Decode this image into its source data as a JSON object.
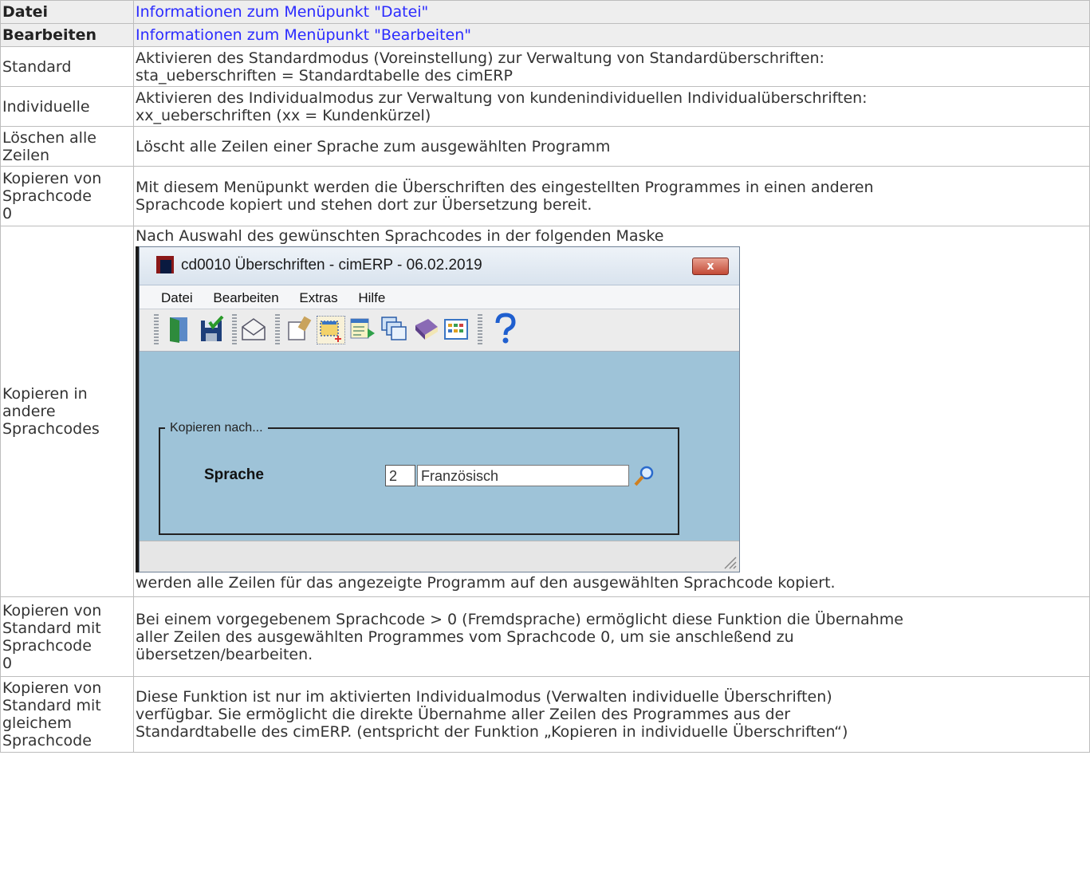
{
  "rows": [
    {
      "key": "Datei",
      "link": "Informationen zum Menüpunkt \"Datei\""
    },
    {
      "key": "Bearbeiten",
      "link": "Informationen zum Menüpunkt \"Bearbeiten\""
    },
    {
      "key": "Standard",
      "desc_lines": [
        "Aktivieren des Standardmodus (Voreinstellung) zur Verwaltung von Standardüberschriften:",
        "sta_ueberschriften = Standardtabelle des cimERP"
      ]
    },
    {
      "key": "Individuelle",
      "desc_lines": [
        "Aktivieren des Individualmodus zur Verwaltung von kundenindividuellen Individualüberschriften:",
        "xx_ueberschriften (xx = Kundenkürzel)"
      ]
    },
    {
      "key_lines": [
        "Löschen alle",
        "Zeilen"
      ],
      "desc": "Löscht alle Zeilen einer Sprache zum ausgewählten Programm"
    },
    {
      "key_lines": [
        "Kopieren von",
        "Sprachcode",
        "0"
      ],
      "desc_lines": [
        "Mit diesem Menüpunkt werden die Überschriften des eingestellten Programmes in einen anderen",
        "Sprachcode kopiert und stehen dort zur Übersetzung bereit."
      ]
    },
    {
      "key_lines": [
        "Kopieren in",
        "andere",
        "Sprachcodes"
      ],
      "desc_before": "Nach Auswahl des gewünschten Sprachcodes in der folgenden Maske",
      "desc_after": "werden alle Zeilen für das angezeigte Programm auf den ausgewählten Sprachcode kopiert."
    },
    {
      "key_lines": [
        "Kopieren von",
        "Standard mit",
        "Sprachcode",
        "0"
      ],
      "desc_lines": [
        "Bei einem vorgegebenem Sprachcode > 0 (Fremdsprache) ermöglicht diese Funktion die Übernahme",
        "aller Zeilen des ausgewählten Programmes vom Sprachcode 0, um sie anschleßend zu",
        "übersetzen/bearbeiten."
      ]
    },
    {
      "key_lines": [
        "Kopieren von",
        "Standard mit",
        "gleichem",
        "Sprachcode"
      ],
      "desc_lines": [
        "Diese Funktion ist nur im aktivierten Individualmodus (Verwalten individuelle Überschriften)",
        "verfügbar. Sie ermöglicht die direkte Übernahme aller Zeilen des Programmes aus der",
        "Standardtabelle des cimERP. (entspricht der Funktion „Kopieren in individuelle Überschriften“)"
      ]
    }
  ],
  "dialog": {
    "title": "cd0010 Überschriften - cimERP - 06.02.2019",
    "close_symbol": "x",
    "menu": [
      "Datei",
      "Bearbeiten",
      "Extras",
      "Hilfe"
    ],
    "toolbar_icons": [
      "exit-icon",
      "save-icon",
      "mail-icon",
      "edit-icon",
      "new-line-icon",
      "transfer-icon",
      "windows-icon",
      "book-icon",
      "grid-icon",
      "help-icon"
    ],
    "group_label": "Kopieren nach...",
    "field_label": "Sprache",
    "code_value": "2",
    "name_value": "Französisch"
  },
  "colors": {
    "link": "#2b2bff",
    "header_bg": "#eeeeee",
    "border": "#bdbdbd",
    "dialog_body": "#9ec3d8"
  }
}
